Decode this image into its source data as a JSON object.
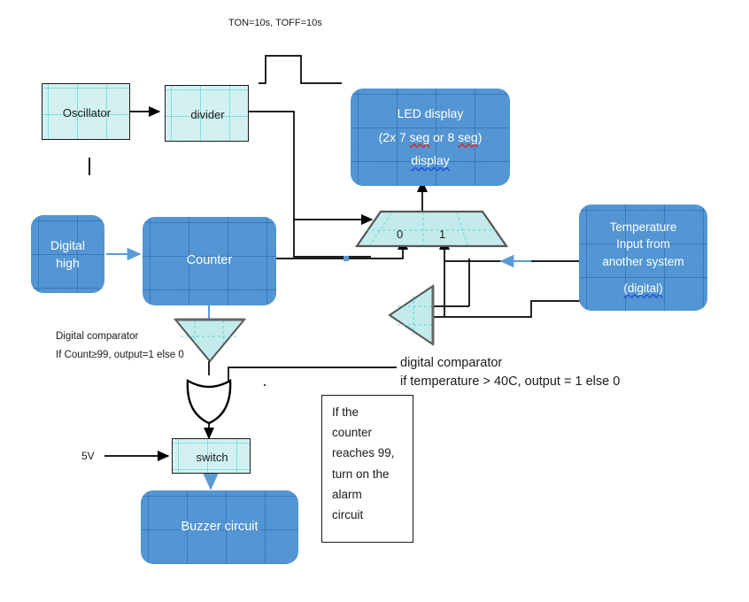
{
  "diagram": {
    "title_note": "TON=10s, TOFF=10s",
    "blocks": {
      "oscillator": "Oscillator",
      "divider": "divider",
      "led_display_line1": "LED display",
      "led_display_line2_a": "(2x 7 ",
      "led_display_line2_seg1": "seg",
      "led_display_line2_b": " or 8 ",
      "led_display_line2_seg2": "seg",
      "led_display_line2_c": ")",
      "led_display_line3": "display",
      "digital_high_line1": "Digital",
      "digital_high_line2": "high",
      "counter": "Counter",
      "temperature_line1": "Temperature",
      "temperature_line2": "Input from",
      "temperature_line3": "another system",
      "temperature_line4": "(digital)",
      "switch": "switch",
      "buzzer": "Buzzer circuit"
    },
    "mux": {
      "input0_label": "0",
      "input1_label": "1"
    },
    "labels": {
      "supply_voltage": "5V",
      "comparator_left_line1": "Digital comparator",
      "comparator_left_line2": "If Count≥99, output=1 else 0",
      "comparator_right_line1": "digital comparator",
      "comparator_right_line2": " if temperature > 40C, output = 1 else 0"
    },
    "note_box": {
      "line1": "If the",
      "line2": "counter",
      "line3": "reaches 99,",
      "line4": "turn on the",
      "line5": "alarm",
      "line6": "circuit"
    },
    "colors": {
      "blue_fill": "#4a90d0",
      "cyan_fill": "#c3ebeb",
      "line_black": "#000000",
      "line_blue": "#5b9bd5",
      "text_white": "#ffffff",
      "text_dark": "#1a1a1a",
      "spell_red": "#e02020",
      "spell_blue": "#1f4fd8"
    }
  }
}
